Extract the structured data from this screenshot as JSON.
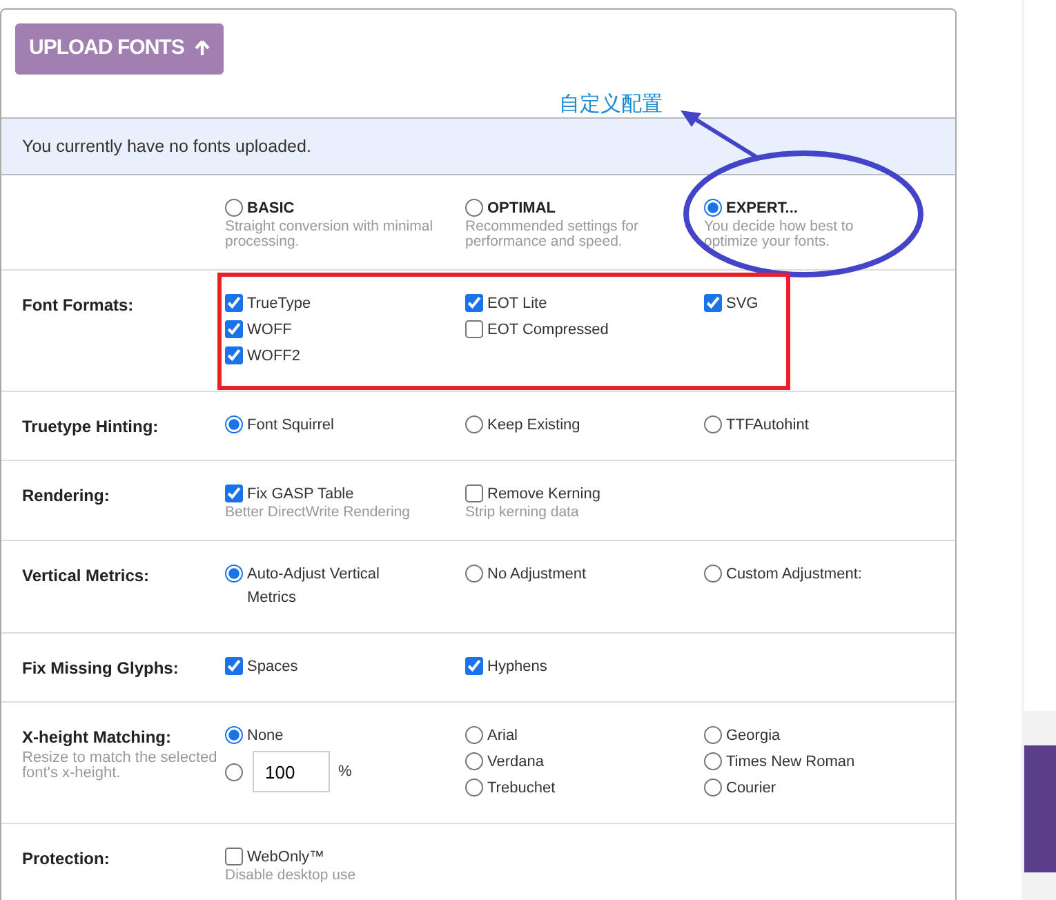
{
  "upload_button": {
    "label": "UPLOAD FONTS"
  },
  "annotation": {
    "text": "自定义配置"
  },
  "notice": "You currently have no fonts uploaded.",
  "modes": [
    {
      "label": "BASIC",
      "description": "Straight conversion with minimal processing.",
      "selected": false
    },
    {
      "label": "OPTIMAL",
      "description": "Recommended settings for performance and speed.",
      "selected": false
    },
    {
      "label": "EXPERT...",
      "description": "You decide how best to optimize your fonts.",
      "selected": true
    }
  ],
  "settings": [
    {
      "label": "Font Formats:",
      "columns": [
        [
          {
            "kind": "checkbox",
            "label": "TrueType",
            "checked": true
          },
          {
            "kind": "checkbox",
            "label": "WOFF",
            "checked": true
          },
          {
            "kind": "checkbox",
            "label": "WOFF2",
            "checked": true
          }
        ],
        [
          {
            "kind": "checkbox",
            "label": "EOT Lite",
            "checked": true
          },
          {
            "kind": "checkbox",
            "label": "EOT Compressed",
            "checked": false
          }
        ],
        [
          {
            "kind": "checkbox",
            "label": "SVG",
            "checked": true
          }
        ]
      ]
    },
    {
      "label": "Truetype Hinting:",
      "columns": [
        [
          {
            "kind": "radio",
            "label": "Font Squirrel",
            "selected": true
          }
        ],
        [
          {
            "kind": "radio",
            "label": "Keep Existing",
            "selected": false
          }
        ],
        [
          {
            "kind": "radio",
            "label": "TTFAutohint",
            "selected": false
          }
        ]
      ]
    },
    {
      "label": "Rendering:",
      "columns": [
        [
          {
            "kind": "checkbox",
            "label": "Fix GASP Table",
            "checked": true,
            "description": "Better DirectWrite Rendering"
          }
        ],
        [
          {
            "kind": "checkbox",
            "label": "Remove Kerning",
            "checked": false,
            "description": "Strip kerning data"
          }
        ]
      ]
    },
    {
      "label": "Vertical Metrics:",
      "columns": [
        [
          {
            "kind": "radio",
            "label": "Auto-Adjust Vertical Metrics",
            "selected": true
          }
        ],
        [
          {
            "kind": "radio",
            "label": "No Adjustment",
            "selected": false
          }
        ],
        [
          {
            "kind": "radio",
            "label": "Custom Adjustment:",
            "selected": false
          }
        ]
      ]
    },
    {
      "label": "Fix Missing Glyphs:",
      "columns": [
        [
          {
            "kind": "checkbox",
            "label": "Spaces",
            "checked": true
          }
        ],
        [
          {
            "kind": "checkbox",
            "label": "Hyphens",
            "checked": true
          }
        ]
      ]
    },
    {
      "label": "X-height Matching:",
      "hint": "Resize to match the selected font's x-height.",
      "columns": [
        [
          {
            "kind": "radio",
            "label": "None",
            "selected": true
          },
          {
            "kind": "radio_input",
            "value": "100",
            "unit": "%",
            "selected": false
          }
        ],
        [
          {
            "kind": "radio",
            "label": "Arial",
            "selected": false
          },
          {
            "kind": "radio",
            "label": "Verdana",
            "selected": false
          },
          {
            "kind": "radio",
            "label": "Trebuchet",
            "selected": false
          }
        ],
        [
          {
            "kind": "radio",
            "label": "Georgia",
            "selected": false
          },
          {
            "kind": "radio",
            "label": "Times New Roman",
            "selected": false
          },
          {
            "kind": "radio",
            "label": "Courier",
            "selected": false
          }
        ]
      ]
    },
    {
      "label": "Protection:",
      "columns": [
        [
          {
            "kind": "checkbox",
            "label": "WebOnly™",
            "checked": false,
            "description": "Disable desktop use"
          }
        ]
      ]
    }
  ]
}
